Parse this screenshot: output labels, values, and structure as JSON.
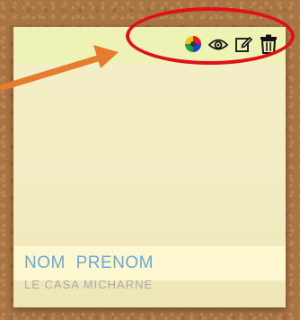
{
  "note": {
    "name": "NOM  PRENOM",
    "secondary_text": "LE CASA MICHARNE"
  },
  "toolbar": {
    "icons": [
      "color-wheel-icon",
      "eye-icon",
      "edit-icon",
      "trash-icon"
    ]
  },
  "colors": {
    "highlight": "#e0101a",
    "arrow": "#e57c2e",
    "name_text": "#6fa6d6"
  }
}
